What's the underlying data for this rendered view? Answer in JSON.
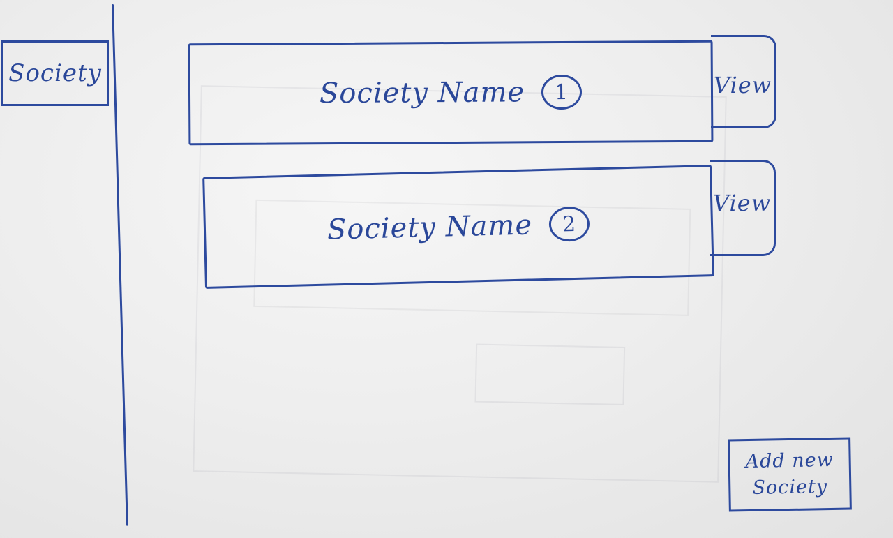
{
  "sidebar": {
    "items": [
      {
        "label": "Society"
      }
    ]
  },
  "main": {
    "societies": [
      {
        "name": "Society Name",
        "number": "1",
        "view_label": "View"
      },
      {
        "name": "Society Name",
        "number": "2",
        "view_label": "View"
      }
    ],
    "add_button": {
      "line1": "Add new",
      "line2": "Society"
    }
  },
  "colors": {
    "ink": "#2d4a9e",
    "paper": "#eeeeee"
  }
}
